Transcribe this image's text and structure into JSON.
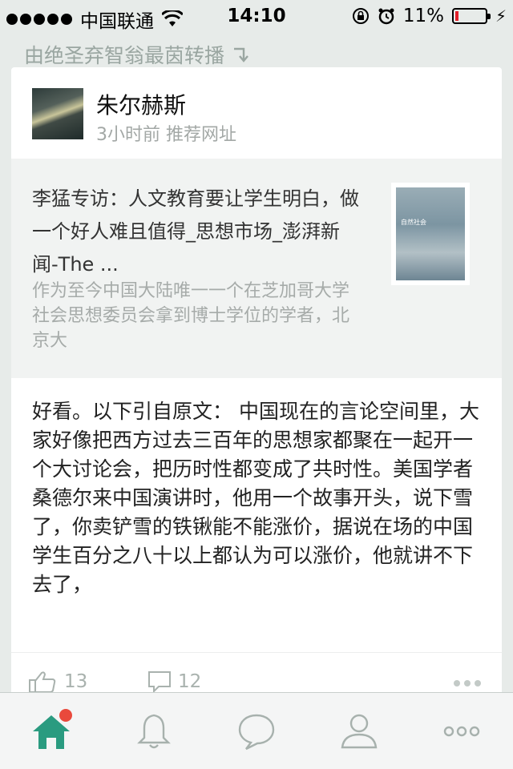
{
  "status_bar": {
    "carrier": "中国联通",
    "time": "14:10",
    "battery_percent": "11%",
    "battery_level": 0.11,
    "icons": [
      "signal-dots-icon",
      "wifi-icon",
      "rotation-lock-icon",
      "alarm-icon",
      "battery-icon",
      "charging-icon"
    ]
  },
  "repost_note": {
    "text": "由绝圣弃智翁最茵转播",
    "icon": "repost-arrow-icon"
  },
  "post": {
    "author_name": "朱尔赫斯",
    "meta": "3小时前 推荐网址",
    "link": {
      "title": "李猛专访：人文教育要让学生明白，做一个好人难且值得_思想市场_澎湃新闻-The ...",
      "description": "作为至今中国大陆唯一一个在芝加哥大学社会思想委员会拿到博士学位的学者，北京大",
      "thumbnail_text": "自然社会"
    },
    "text": "好看。以下引自原文：  中国现在的言论空间里，大家好像把西方过去三百年的思想家都聚在一起开一个大讨论会，把历时性都变成了共时性。美国学者桑德尔来中国演讲时，他用一个故事开头，说下雪了，你卖铲雪的铁锹能不能涨价，据说在场的中国学生百分之八十以上都认为可以涨价，他就讲不下去了，",
    "likes": "13",
    "comments": "12"
  },
  "tab_bar": {
    "tabs": [
      "home-icon",
      "bell-icon",
      "chat-bubble-icon",
      "person-icon",
      "more-icon"
    ],
    "accent_color": "#2a9b80",
    "inactive_color": "#a7b1ad",
    "badge_color": "#e9493c"
  }
}
